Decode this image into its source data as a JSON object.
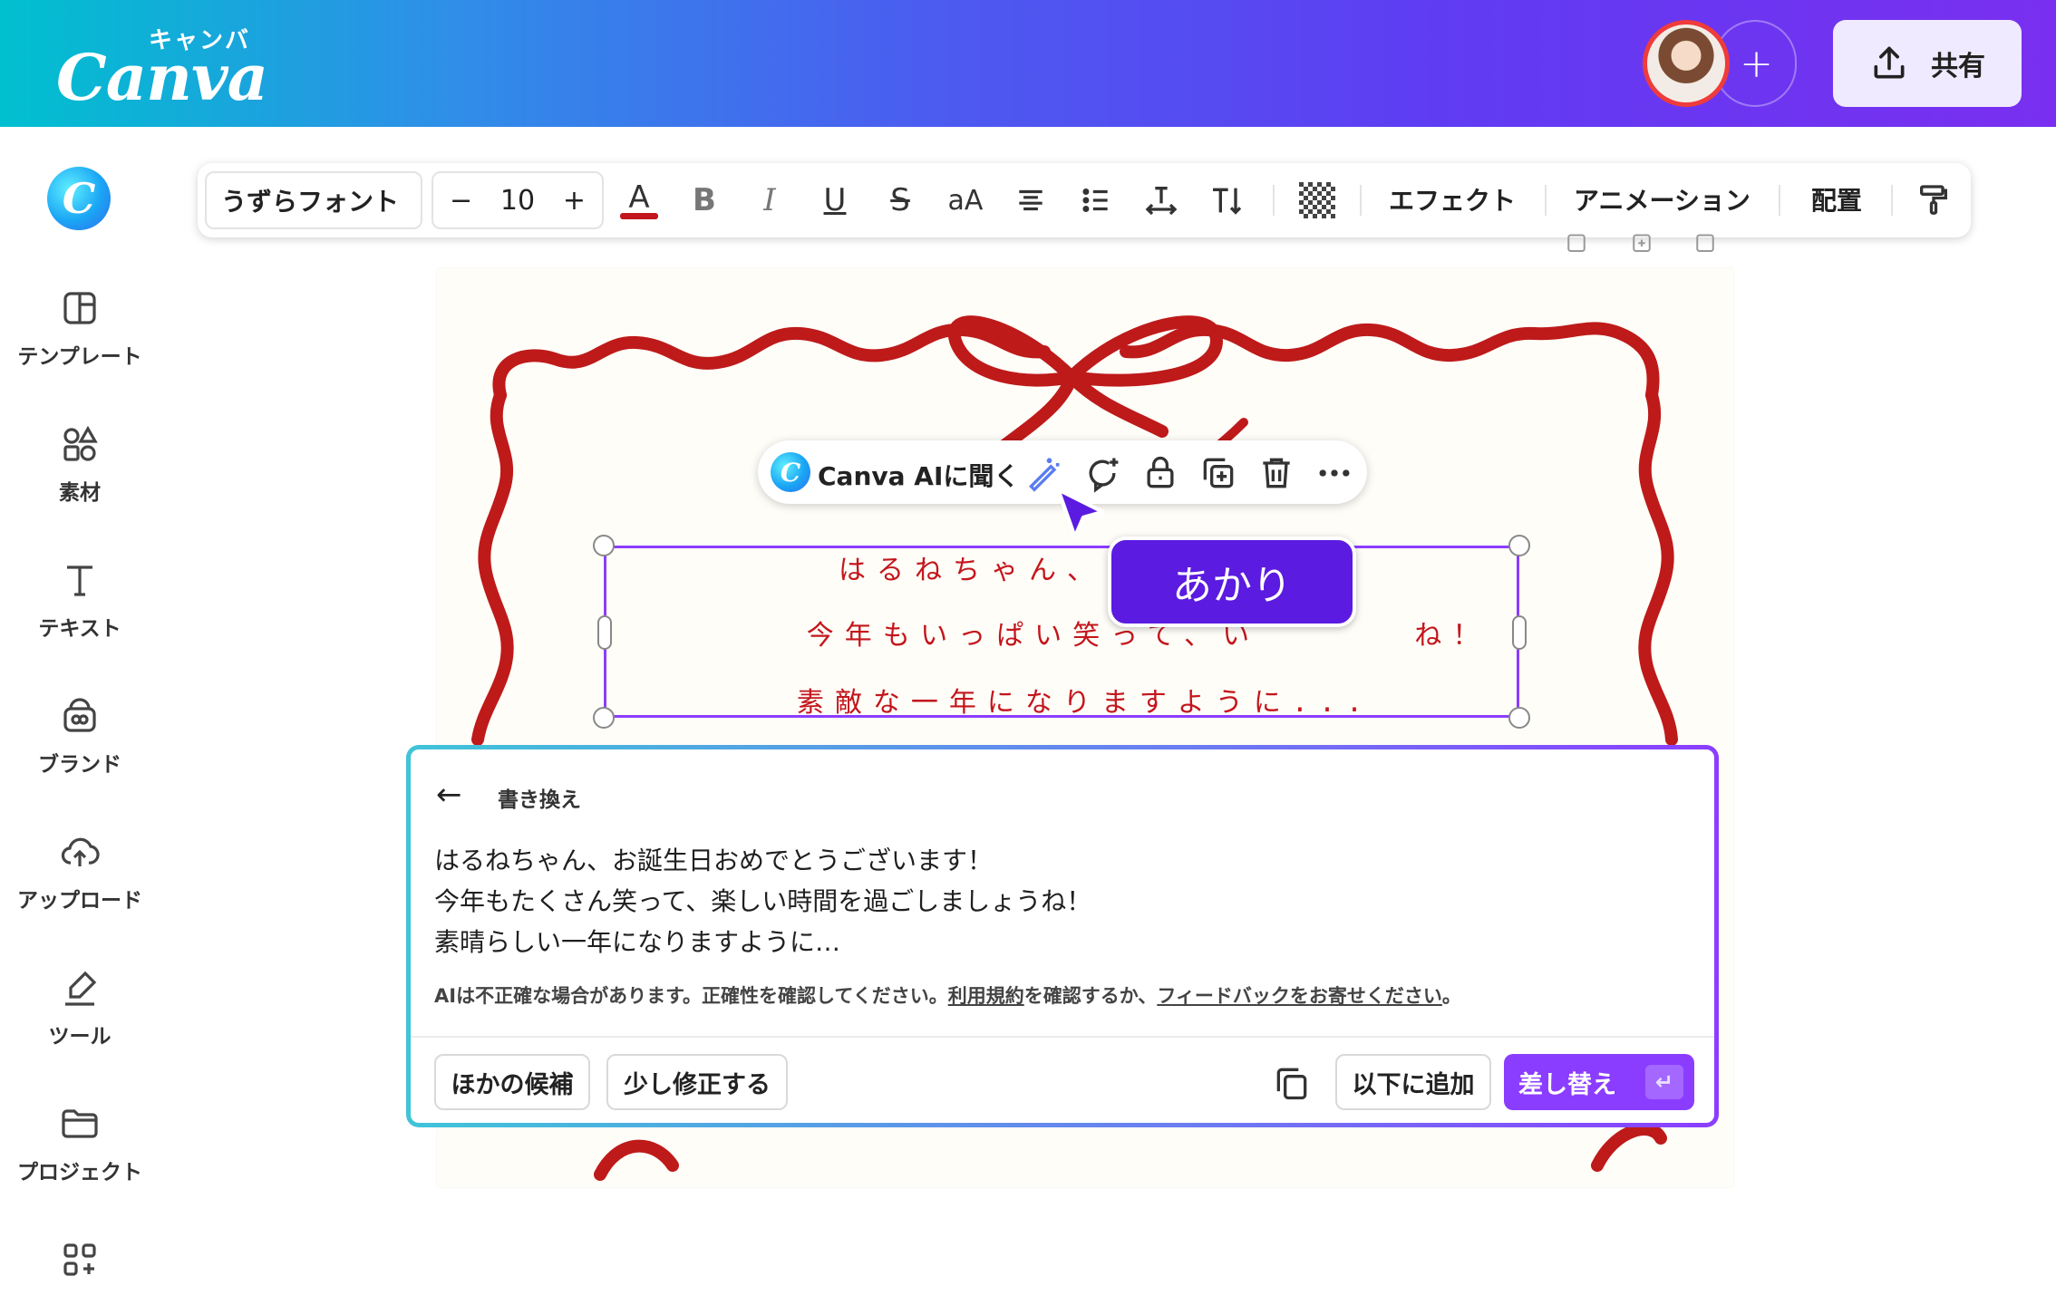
{
  "header": {
    "logo_text": "Canva",
    "logo_kana": "キャンバ",
    "add_collaborator": "+",
    "share_label": "共有"
  },
  "sidebar": {
    "items": [
      {
        "label": "テンプレート",
        "icon": "template-icon"
      },
      {
        "label": "素材",
        "icon": "elements-icon"
      },
      {
        "label": "テキスト",
        "icon": "text-icon"
      },
      {
        "label": "ブランド",
        "icon": "brand-icon"
      },
      {
        "label": "アップロード",
        "icon": "upload-cloud-icon"
      },
      {
        "label": "ツール",
        "icon": "tools-icon"
      },
      {
        "label": "プロジェクト",
        "icon": "folder-icon"
      }
    ]
  },
  "toolbar": {
    "font_name": "うずらフォント",
    "decrease": "−",
    "font_size": "10",
    "increase": "+",
    "font_color_glyph": "A",
    "bold_glyph": "B",
    "italic_glyph": "I",
    "underline_glyph": "U",
    "strike_glyph": "S",
    "case_glyph": "aA",
    "effects_label": "エフェクト",
    "animation_label": "アニメーション",
    "position_label": "配置",
    "accent_color": "#c3161c"
  },
  "context_bar": {
    "ai_label": "Canva AIに聞く"
  },
  "card": {
    "lines": [
      "はるねちゃん、お誕生",
      "今年もいっぱい笑って、い",
      "素敵な一年になりますように..."
    ],
    "line2_tail": "ね！",
    "ribbon_color": "#be1a1a"
  },
  "collaborator_tag": {
    "name": "あかり",
    "color": "#5b1be0"
  },
  "rewrite_panel": {
    "title": "書き換え",
    "text_lines": [
      "はるねちゃん、お誕生日おめでとうございます！",
      "今年もたくさん笑って、楽しい時間を過ごしましょうね！",
      "素晴らしい一年になりますように…"
    ],
    "note_prefix": "AIは不正確な場合があります。正確性を確認してください。",
    "terms_link": "利用規約",
    "note_middle": "を確認するか、",
    "feedback_link": "フィードバックをお寄せください",
    "note_suffix": "。",
    "other_options": "ほかの候補",
    "adjust": "少し修正する",
    "insert_below": "以下に追加",
    "replace": "差し替え",
    "enter_glyph": "↵",
    "primary_color": "#8b3dff"
  }
}
